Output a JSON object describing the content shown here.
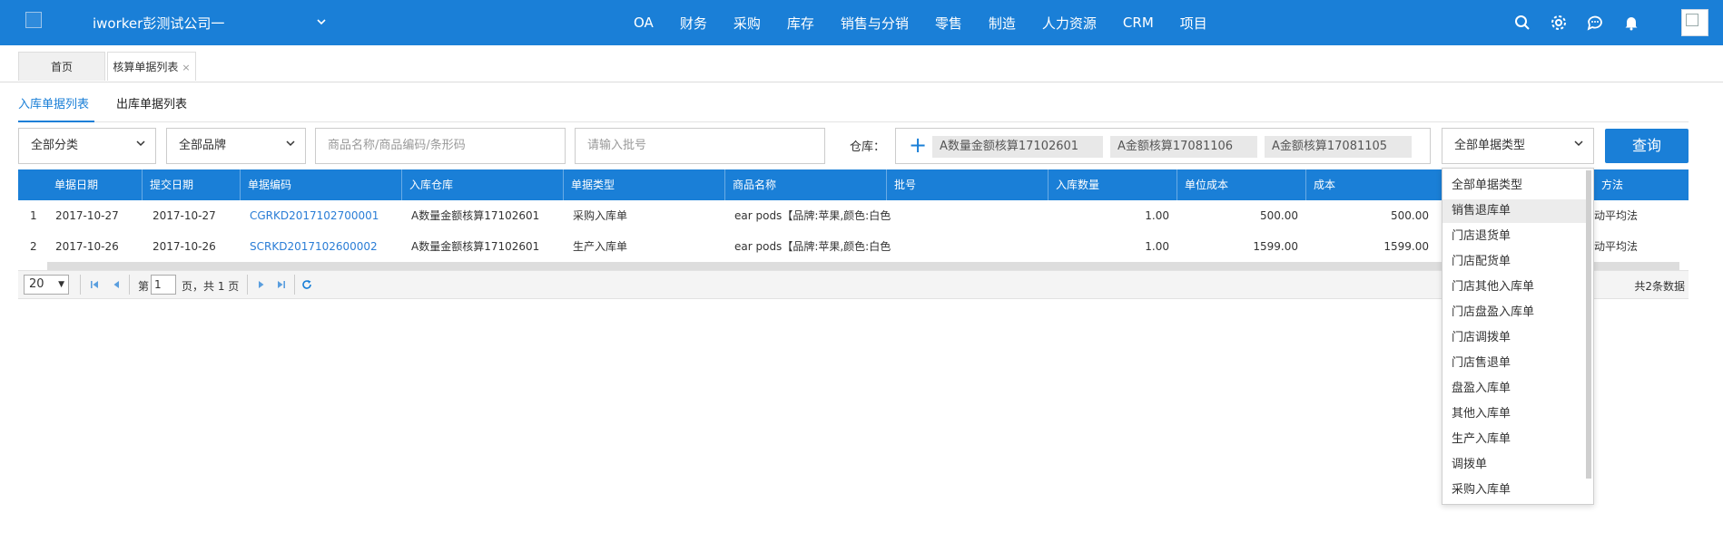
{
  "header": {
    "company": "iworker彭测试公司一",
    "nav": [
      "OA",
      "财务",
      "采购",
      "库存",
      "销售与分销",
      "零售",
      "制造",
      "人力资源",
      "CRM",
      "项目"
    ]
  },
  "page_tabs": {
    "home": "首页",
    "current": "核算单据列表",
    "close": "×"
  },
  "sub_tabs": {
    "inbound": "入库单据列表",
    "outbound": "出库单据列表"
  },
  "filters": {
    "category": "全部分类",
    "brand": "全部品牌",
    "product_placeholder": "商品名称/商品编码/条形码",
    "batch_placeholder": "请输入批号",
    "warehouse_label": "仓库：",
    "warehouse_plus": "+",
    "warehouses": [
      "A数量金额核算17102601",
      "A金额核算17081106",
      "A金额核算17081105"
    ],
    "doc_type": "全部单据类型",
    "query_button": "查询"
  },
  "table": {
    "columns": [
      "单据日期",
      "提交日期",
      "单据编码",
      "入库仓库",
      "单据类型",
      "商品名称",
      "批号",
      "入库数量",
      "单位成本",
      "成本",
      "方法"
    ],
    "rows": [
      {
        "idx": "1",
        "date": "2017-10-27",
        "submit": "2017-10-27",
        "code": "CGRKD2017102700001",
        "warehouse": "A数量金额核算17102601",
        "type": "采购入库单",
        "product": "ear pods【品牌:苹果,颜色:白色",
        "batch": "",
        "qty": "1.00",
        "unit_cost": "500.00",
        "cost": "500.00",
        "method": "动平均法"
      },
      {
        "idx": "2",
        "date": "2017-10-26",
        "submit": "2017-10-26",
        "code": "SCRKD2017102600002",
        "warehouse": "A数量金额核算17102601",
        "type": "生产入库单",
        "product": "ear pods【品牌:苹果,颜色:白色",
        "batch": "",
        "qty": "1.00",
        "unit_cost": "1599.00",
        "cost": "1599.00",
        "method": "动平均法"
      }
    ]
  },
  "pager": {
    "page_size": "20",
    "page_prefix": "第",
    "page_value": "1",
    "page_suffix": "页，共 1 页",
    "total": "共2条数据"
  },
  "dropdown": {
    "items": [
      "全部单据类型",
      "销售退库单",
      "门店退货单",
      "门店配货单",
      "门店其他入库单",
      "门店盘盈入库单",
      "门店调拨单",
      "门店售退单",
      "盘盈入库单",
      "其他入库单",
      "生产入库单",
      "调拨单",
      "采购入库单"
    ],
    "highlighted_index": 1
  },
  "colors": {
    "primary": "#1a7fd7",
    "link": "#2a7dd6"
  }
}
